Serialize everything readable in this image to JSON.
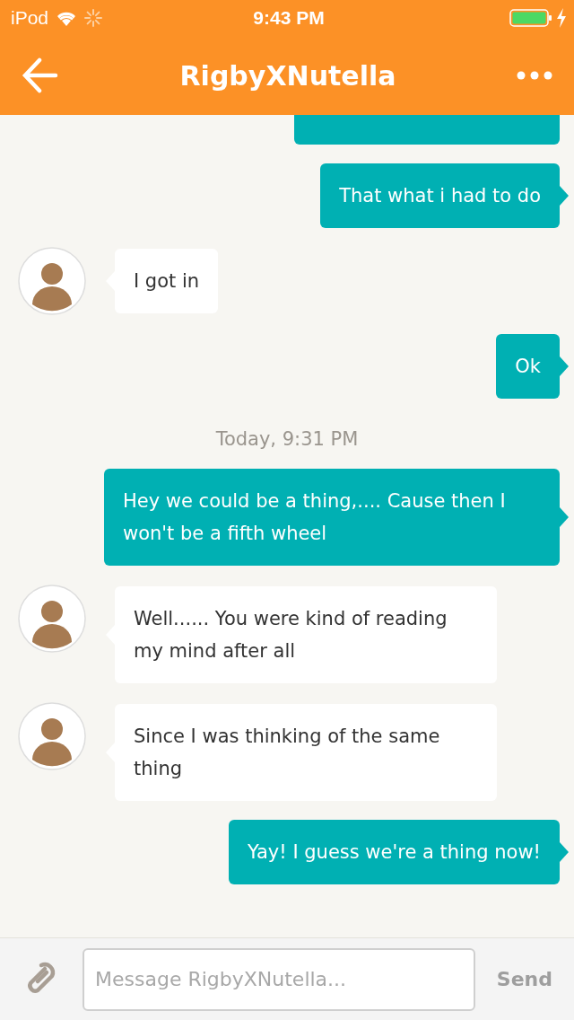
{
  "status_bar": {
    "carrier": "iPod",
    "time": "9:43 PM",
    "battery_charging": true
  },
  "header": {
    "title": "RigbyXNutella"
  },
  "messages": [
    {
      "kind": "clipped_sent"
    },
    {
      "kind": "sent",
      "text": "That what i had to do"
    },
    {
      "kind": "received",
      "text": "I got in"
    },
    {
      "kind": "sent",
      "text": "Ok"
    },
    {
      "kind": "timestamp",
      "text": "Today, 9:31 PM"
    },
    {
      "kind": "sent",
      "text": " Hey we could be a thing,.... Cause then I won't be a fifth wheel"
    },
    {
      "kind": "received",
      "text": "Well...... You were kind of reading my mind after all"
    },
    {
      "kind": "received",
      "text": "Since I was thinking of the same thing"
    },
    {
      "kind": "sent",
      "text": "Yay! I guess we're a thing now!"
    }
  ],
  "composer": {
    "placeholder": "Message RigbyXNutella...",
    "send": {
      "label": "Send",
      "disabled": true
    }
  }
}
